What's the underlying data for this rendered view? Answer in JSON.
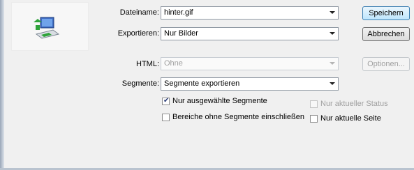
{
  "form": {
    "filename_label": "Dateiname:",
    "filename_value": "hinter.gif",
    "export_label": "Exportieren:",
    "export_value": "Nur Bilder",
    "html_label": "HTML:",
    "html_value": "Ohne",
    "segments_label": "Segmente:",
    "segments_value": "Segmente exportieren"
  },
  "buttons": {
    "save": "Speichern",
    "cancel": "Abbrechen",
    "options": "Optionen..."
  },
  "checkboxes": {
    "selected_segments": {
      "label": "Nur ausgewählte Segmente",
      "checked": true
    },
    "include_areas": {
      "label": "Bereiche ohne Segmente einschließen",
      "checked": false
    },
    "current_status": {
      "label": "Nur aktueller Status",
      "checked": false
    },
    "current_page": {
      "label": "Nur aktuelle Seite",
      "checked": false
    }
  },
  "icons": {
    "export_icon": "computer-export-icon"
  }
}
